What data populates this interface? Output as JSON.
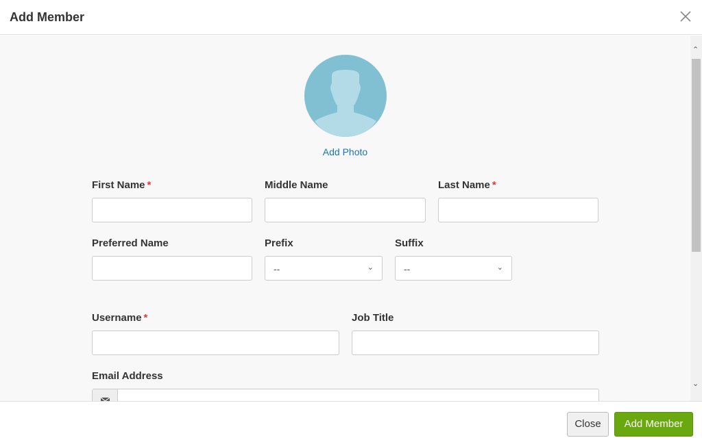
{
  "header": {
    "title": "Add Member"
  },
  "avatar": {
    "add_photo": "Add Photo"
  },
  "form": {
    "first_name": "First Name",
    "middle_name": "Middle Name",
    "last_name": "Last Name",
    "preferred_name": "Preferred Name",
    "prefix": "Prefix",
    "suffix": "Suffix",
    "prefix_value": "--",
    "suffix_value": "--",
    "username": "Username",
    "job_title": "Job Title",
    "email": "Email Address",
    "required_mark": "*"
  },
  "footer": {
    "close": "Close",
    "add_member": "Add Member"
  },
  "colors": {
    "accent": "#69a80f",
    "link": "#1a73b8",
    "required": "#ee3333"
  }
}
